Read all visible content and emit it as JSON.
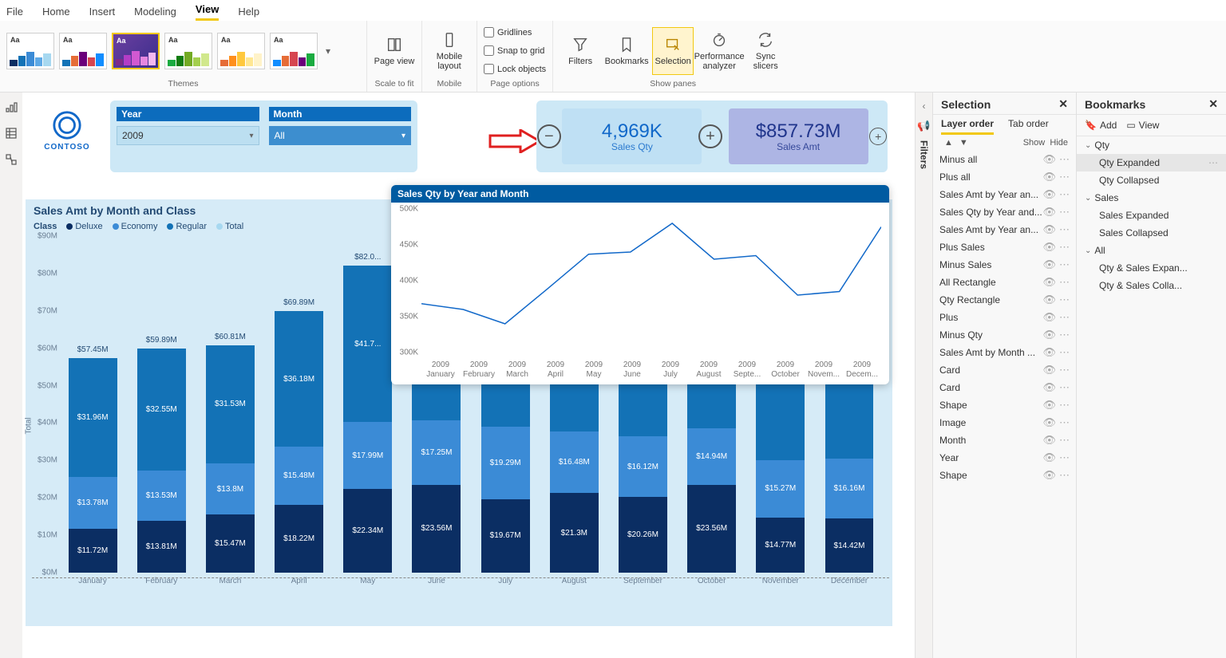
{
  "menu": {
    "file": "File",
    "home": "Home",
    "insert": "Insert",
    "modeling": "Modeling",
    "view": "View",
    "help": "Help"
  },
  "ribbon": {
    "themes_label": "Themes",
    "scale_label": "Scale to fit",
    "mobile_label": "Mobile",
    "page_opts_label": "Page options",
    "show_panes_label": "Show panes",
    "page_view": "Page view",
    "mobile_layout": "Mobile layout",
    "gridlines": "Gridlines",
    "snap": "Snap to grid",
    "lock": "Lock objects",
    "filters": "Filters",
    "bookmarks": "Bookmarks",
    "selection": "Selection",
    "perf": "Performance analyzer",
    "sync": "Sync slicers"
  },
  "logo": "CONTOSO",
  "slicers": {
    "year_label": "Year",
    "year_value": "2009",
    "month_label": "Month",
    "month_value": "All"
  },
  "cards": {
    "qty_val": "4,969K",
    "qty_lab": "Sales Qty",
    "amt_val": "$857.73M",
    "amt_lab": "Sales Amt"
  },
  "filters_tab": "Filters",
  "selection_pane": {
    "title": "Selection",
    "tab_layer": "Layer order",
    "tab_tab": "Tab order",
    "show": "Show",
    "hide": "Hide",
    "items": [
      "Minus all",
      "Plus all",
      "Sales Amt by Year an...",
      "Sales Qty by Year and...",
      "Sales Amt by Year an...",
      "Plus Sales",
      "Minus Sales",
      "All Rectangle",
      "Qty Rectangle",
      "Plus",
      "Minus Qty",
      "Sales Amt by Month ...",
      "Card",
      "Card",
      "Shape",
      "Image",
      "Month",
      "Year",
      "Shape"
    ]
  },
  "bookmarks_pane": {
    "title": "Bookmarks",
    "add": "Add",
    "view": "View",
    "groups": [
      {
        "name": "Qty",
        "items": [
          "Qty Expanded",
          "Qty Collapsed"
        ],
        "selected": 0
      },
      {
        "name": "Sales",
        "items": [
          "Sales Expanded",
          "Sales Collapsed"
        ],
        "selected": -1
      },
      {
        "name": "All",
        "items": [
          "Qty & Sales Expan...",
          "Qty & Sales Colla..."
        ],
        "selected": -1
      }
    ]
  },
  "chart_data": [
    {
      "type": "bar",
      "title": "Sales Amt by Month and Class",
      "ylabel": "Total",
      "ylim": [
        0,
        90
      ],
      "y_unit": "M",
      "y_prefix": "$",
      "categories": [
        "January",
        "February",
        "March",
        "April",
        "May",
        "June",
        "July",
        "August",
        "September",
        "October",
        "November",
        "December"
      ],
      "legend_title": "Class",
      "series": [
        {
          "name": "Deluxe",
          "color": "#0b2e63",
          "values": [
            11.72,
            13.81,
            15.47,
            18.22,
            22.34,
            23.56,
            19.67,
            21.3,
            20.26,
            23.56,
            14.77,
            14.42
          ]
        },
        {
          "name": "Economy",
          "color": "#3b8bd6",
          "values": [
            13.78,
            13.53,
            13.8,
            15.48,
            17.99,
            17.25,
            19.29,
            16.48,
            16.12,
            14.94,
            15.27,
            16.16
          ]
        },
        {
          "name": "Regular",
          "color": "#1372b6",
          "values": [
            31.96,
            32.55,
            31.53,
            36.18,
            41.7,
            40.0,
            41.0,
            43.0,
            44.0,
            46.0,
            38.0,
            38.0
          ]
        },
        {
          "name": "Total",
          "color": "#a7d8f0",
          "values": [
            57.45,
            59.89,
            60.81,
            69.89,
            82.0,
            80.8,
            80.0,
            80.8,
            80.4,
            84.5,
            68.0,
            68.6
          ]
        }
      ],
      "total_labels": [
        "$57.45M",
        "$59.89M",
        "$60.81M",
        "$69.89M",
        "$82.0...",
        "",
        "",
        "",
        "",
        "",
        "",
        ""
      ],
      "seg_labels": [
        [
          "$11.72M",
          "$13.81M",
          "$15.47M",
          "$18.22M",
          "$22.34M",
          "$23.56M",
          "$19.67M",
          "$21.3M",
          "$20.26M",
          "$23.56M",
          "$14.77M",
          "$14.42M"
        ],
        [
          "$13.78M",
          "$13.53M",
          "$13.8M",
          "$15.48M",
          "$17.99M",
          "$17.25M",
          "$19.29M",
          "$16.48M",
          "$16.12M",
          "$14.94M",
          "$15.27M",
          "$16.16M"
        ],
        [
          "$31.96M",
          "$32.55M",
          "$31.53M",
          "$36.18M",
          "$41.7...",
          "",
          "",
          "",
          "",
          "",
          "",
          ""
        ]
      ]
    },
    {
      "type": "line",
      "title": "Sales Qty by Year and Month",
      "ylim": [
        300,
        500
      ],
      "y_unit": "K",
      "x_year": "2009",
      "categories": [
        "January",
        "February",
        "March",
        "April",
        "May",
        "June",
        "July",
        "August",
        "Septe...",
        "October",
        "Novem...",
        "Decem..."
      ],
      "values": [
        368,
        360,
        340,
        388,
        437,
        440,
        480,
        430,
        435,
        380,
        385,
        475
      ]
    }
  ]
}
